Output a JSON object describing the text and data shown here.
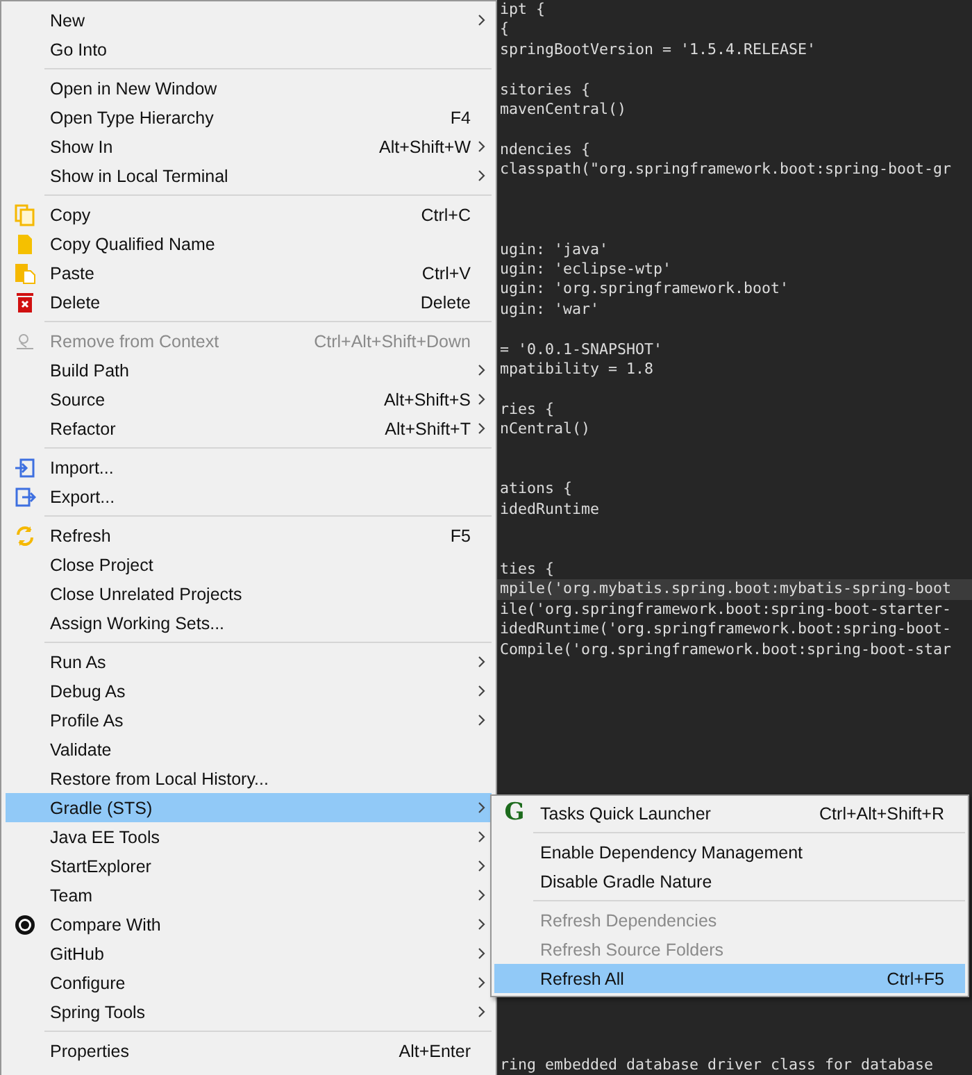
{
  "editor": {
    "lines": [
      {
        "kind": "code",
        "text": "ipt {",
        "current": false
      },
      {
        "kind": "code",
        "text": "{",
        "current": false
      },
      {
        "kind": "code",
        "text": "springBootVersion = '1.5.4.RELEASE'",
        "current": false
      },
      {
        "kind": "blank",
        "current": false
      },
      {
        "kind": "code",
        "text": "sitories {",
        "current": false
      },
      {
        "kind": "code",
        "text": "mavenCentral()",
        "current": false
      },
      {
        "kind": "blank",
        "current": false
      },
      {
        "kind": "code",
        "text": "ndencies {",
        "current": false
      },
      {
        "kind": "code",
        "text": "classpath(\"org.springframework.boot:spring-boot-gr",
        "current": false
      },
      {
        "kind": "blank",
        "current": false
      },
      {
        "kind": "blank",
        "current": false
      },
      {
        "kind": "blank",
        "current": false
      },
      {
        "kind": "code",
        "text": "ugin: 'java'",
        "current": false
      },
      {
        "kind": "code",
        "text": "ugin: 'eclipse-wtp'",
        "current": false
      },
      {
        "kind": "code",
        "text": "ugin: 'org.springframework.boot'",
        "current": false
      },
      {
        "kind": "code",
        "text": "ugin: 'war'",
        "current": false
      },
      {
        "kind": "blank",
        "current": false
      },
      {
        "kind": "code",
        "text": "= '0.0.1-SNAPSHOT'",
        "current": false
      },
      {
        "kind": "code",
        "text": "mpatibility = 1.8",
        "current": false
      },
      {
        "kind": "blank",
        "current": false
      },
      {
        "kind": "code",
        "text": "ries {",
        "current": false
      },
      {
        "kind": "code",
        "text": "nCentral()",
        "current": false
      },
      {
        "kind": "blank",
        "current": false
      },
      {
        "kind": "blank",
        "current": false
      },
      {
        "kind": "code",
        "text": "ations {",
        "current": false
      },
      {
        "kind": "code",
        "text": "idedRuntime",
        "current": false
      },
      {
        "kind": "blank",
        "current": false
      },
      {
        "kind": "blank",
        "current": false
      },
      {
        "kind": "code",
        "text": "ties {",
        "current": false
      },
      {
        "kind": "code",
        "text": "mpile('org.mybatis.spring.boot:mybatis-spring-boot",
        "current": true
      },
      {
        "kind": "code",
        "text": "ile('org.springframework.boot:spring-boot-starter-",
        "current": false
      },
      {
        "kind": "code",
        "text": "idedRuntime('org.springframework.boot:spring-boot-",
        "current": false
      },
      {
        "kind": "code",
        "text": "Compile('org.springframework.boot:spring-boot-star",
        "current": false
      }
    ],
    "bottom_line": "ring embedded database driver class for database"
  },
  "context_menu": {
    "items": [
      {
        "kind": "item",
        "label": "New",
        "submenu": true,
        "disabled": false,
        "selected": false
      },
      {
        "kind": "item",
        "label": "Go Into",
        "submenu": false,
        "disabled": false,
        "selected": false
      },
      {
        "kind": "separator"
      },
      {
        "kind": "item",
        "label": "Open in New Window",
        "submenu": false,
        "disabled": false,
        "selected": false
      },
      {
        "kind": "item",
        "label": "Open Type Hierarchy",
        "shortcut": "F4",
        "submenu": false,
        "disabled": false,
        "selected": false
      },
      {
        "kind": "item",
        "label": "Show In",
        "shortcut": "Alt+Shift+W",
        "submenu": true,
        "disabled": false,
        "selected": false
      },
      {
        "kind": "item",
        "label": "Show in Local Terminal",
        "submenu": true,
        "disabled": false,
        "selected": false
      },
      {
        "kind": "separator"
      },
      {
        "kind": "item",
        "label": "Copy",
        "shortcut": "Ctrl+C",
        "submenu": false,
        "disabled": false,
        "selected": false
      },
      {
        "kind": "item",
        "label": "Copy Qualified Name",
        "submenu": false,
        "disabled": false,
        "selected": false
      },
      {
        "kind": "item",
        "label": "Paste",
        "shortcut": "Ctrl+V",
        "submenu": false,
        "disabled": false,
        "selected": false
      },
      {
        "kind": "item",
        "label": "Delete",
        "shortcut": "Delete",
        "submenu": false,
        "disabled": false,
        "selected": false
      },
      {
        "kind": "separator"
      },
      {
        "kind": "item",
        "label": "Remove from Context",
        "shortcut": "Ctrl+Alt+Shift+Down",
        "submenu": false,
        "disabled": true,
        "selected": false
      },
      {
        "kind": "item",
        "label": "Build Path",
        "submenu": true,
        "disabled": false,
        "selected": false
      },
      {
        "kind": "item",
        "label": "Source",
        "shortcut": "Alt+Shift+S",
        "submenu": true,
        "disabled": false,
        "selected": false
      },
      {
        "kind": "item",
        "label": "Refactor",
        "shortcut": "Alt+Shift+T",
        "submenu": true,
        "disabled": false,
        "selected": false
      },
      {
        "kind": "separator"
      },
      {
        "kind": "item",
        "label": "Import...",
        "submenu": false,
        "disabled": false,
        "selected": false
      },
      {
        "kind": "item",
        "label": "Export...",
        "submenu": false,
        "disabled": false,
        "selected": false
      },
      {
        "kind": "separator"
      },
      {
        "kind": "item",
        "label": "Refresh",
        "shortcut": "F5",
        "submenu": false,
        "disabled": false,
        "selected": false
      },
      {
        "kind": "item",
        "label": "Close Project",
        "submenu": false,
        "disabled": false,
        "selected": false
      },
      {
        "kind": "item",
        "label": "Close Unrelated Projects",
        "submenu": false,
        "disabled": false,
        "selected": false
      },
      {
        "kind": "item",
        "label": "Assign Working Sets...",
        "submenu": false,
        "disabled": false,
        "selected": false
      },
      {
        "kind": "separator"
      },
      {
        "kind": "item",
        "label": "Run As",
        "submenu": true,
        "disabled": false,
        "selected": false
      },
      {
        "kind": "item",
        "label": "Debug As",
        "submenu": true,
        "disabled": false,
        "selected": false
      },
      {
        "kind": "item",
        "label": "Profile As",
        "submenu": true,
        "disabled": false,
        "selected": false
      },
      {
        "kind": "item",
        "label": "Validate",
        "submenu": false,
        "disabled": false,
        "selected": false
      },
      {
        "kind": "item",
        "label": "Restore from Local History...",
        "submenu": false,
        "disabled": false,
        "selected": false
      },
      {
        "kind": "item",
        "label": "Gradle (STS)",
        "submenu": true,
        "disabled": false,
        "selected": true
      },
      {
        "kind": "item",
        "label": "Java EE Tools",
        "submenu": true,
        "disabled": false,
        "selected": false
      },
      {
        "kind": "item",
        "label": "StartExplorer",
        "submenu": true,
        "disabled": false,
        "selected": false
      },
      {
        "kind": "item",
        "label": "Team",
        "submenu": true,
        "disabled": false,
        "selected": false
      },
      {
        "kind": "item",
        "label": "Compare With",
        "submenu": true,
        "disabled": false,
        "selected": false
      },
      {
        "kind": "item",
        "label": "GitHub",
        "submenu": true,
        "disabled": false,
        "selected": false
      },
      {
        "kind": "item",
        "label": "Configure",
        "submenu": true,
        "disabled": false,
        "selected": false
      },
      {
        "kind": "item",
        "label": "Spring Tools",
        "submenu": true,
        "disabled": false,
        "selected": false
      },
      {
        "kind": "separator"
      },
      {
        "kind": "item",
        "label": "Properties",
        "shortcut": "Alt+Enter",
        "submenu": false,
        "disabled": false,
        "selected": false
      }
    ]
  },
  "gradle_submenu": {
    "items": [
      {
        "kind": "item",
        "badge": "G",
        "label": "Tasks Quick Launcher",
        "shortcut": "Ctrl+Alt+Shift+R",
        "disabled": false,
        "selected": false
      },
      {
        "kind": "separator"
      },
      {
        "kind": "item",
        "label": "Enable Dependency Management",
        "disabled": false,
        "selected": false
      },
      {
        "kind": "item",
        "label": "Disable Gradle Nature",
        "disabled": false,
        "selected": false
      },
      {
        "kind": "separator"
      },
      {
        "kind": "item",
        "label": "Refresh Dependencies",
        "disabled": true,
        "selected": false
      },
      {
        "kind": "item",
        "label": "Refresh Source Folders",
        "disabled": true,
        "selected": false
      },
      {
        "kind": "item",
        "label": "Refresh All",
        "shortcut": "Ctrl+F5",
        "disabled": false,
        "selected": true
      }
    ]
  }
}
